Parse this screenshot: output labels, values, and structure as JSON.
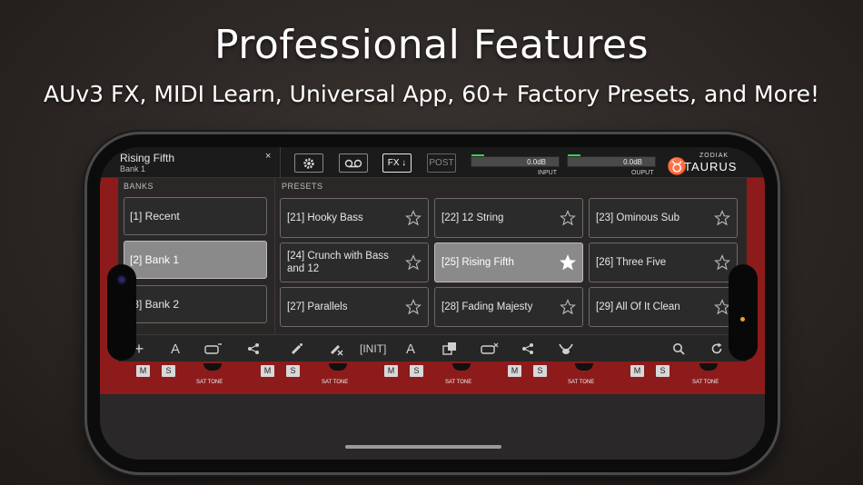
{
  "headline": "Professional Features",
  "subhead": "AUv3 FX, MIDI Learn, Universal App, 60+ Factory Presets, and More!",
  "topbar": {
    "preset_name": "Rising Fifth",
    "bank_name": "Bank 1",
    "close_label": "×",
    "fx_label": "FX ↓",
    "post_label": "POST",
    "input_value": "0.0dB",
    "input_label": "INPUT",
    "output_value": "0.0dB",
    "output_label": "OUPUT",
    "brand_small": "ZODIAK",
    "brand_big": "TAURUS",
    "brand_logo": "♉"
  },
  "banks": {
    "label": "BANKS",
    "items": [
      {
        "label": "[1] Recent",
        "selected": false
      },
      {
        "label": "[2] Bank 1",
        "selected": true
      },
      {
        "label": "[3] Bank 2",
        "selected": false
      }
    ]
  },
  "presets": {
    "label": "PRESETS",
    "items": [
      {
        "label": "[21] Hooky Bass",
        "selected": false,
        "starred": false
      },
      {
        "label": "[22] 12 String",
        "selected": false,
        "starred": false
      },
      {
        "label": "[23] Ominous Sub",
        "selected": false,
        "starred": false
      },
      {
        "label": "[24] Crunch with Bass and 12",
        "selected": false,
        "starred": false
      },
      {
        "label": "[25] Rising Fifth",
        "selected": true,
        "starred": true
      },
      {
        "label": "[26] Three Five",
        "selected": false,
        "starred": false
      },
      {
        "label": "[27] Parallels",
        "selected": false,
        "starred": false
      },
      {
        "label": "[28] Fading Majesty",
        "selected": false,
        "starred": false
      },
      {
        "label": "[29] All Of It Clean",
        "selected": false,
        "starred": false
      }
    ]
  },
  "bottombar": {
    "init_label": "[INIT]",
    "icons": [
      "add-icon",
      "font-icon",
      "bank-rename-icon",
      "share-icon",
      "wand-icon",
      "wand-cancel-icon",
      "font-icon",
      "copy-icon",
      "preset-rename-icon",
      "share-icon",
      "bull-icon",
      "search-icon",
      "refresh-icon"
    ]
  },
  "strip": {
    "mute_label": "M",
    "solo_label": "S",
    "sat_label": "SAT TONE"
  },
  "colors": {
    "rack_red": "#8d1b1b",
    "meter_green": "#3ccf4a",
    "selected_gray": "#8a8a8a"
  }
}
